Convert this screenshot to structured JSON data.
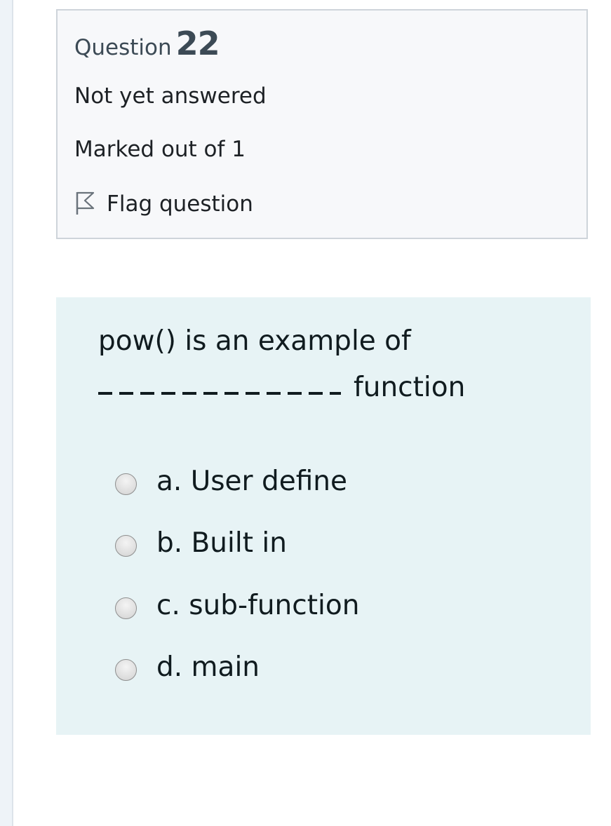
{
  "info": {
    "question_word": "Question",
    "question_number": "22",
    "state": "Not yet answered",
    "grade": "Marked out of 1",
    "flag_label": "Flag question",
    "flag_icon": "flag-outline-icon"
  },
  "question": {
    "text_line1": "pow() is an example of",
    "text_line2_suffix": "function",
    "options": [
      {
        "label": "a. User define",
        "selected": false
      },
      {
        "label": "b. Built in",
        "selected": false
      },
      {
        "label": "c. sub-function",
        "selected": false
      },
      {
        "label": "d. main",
        "selected": false
      }
    ]
  }
}
